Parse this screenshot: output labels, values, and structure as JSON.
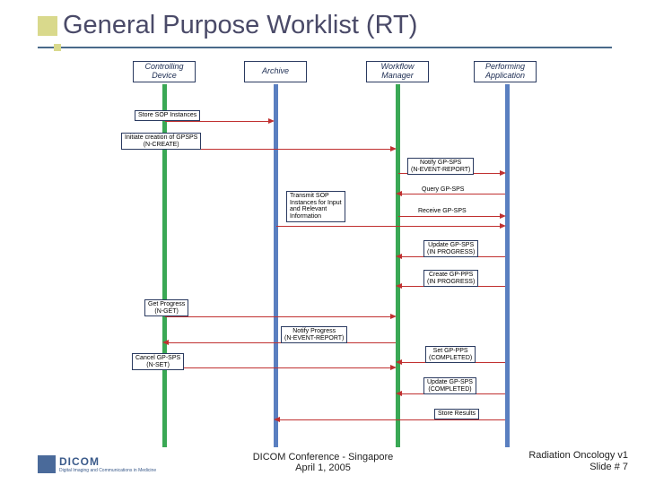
{
  "title": "General Purpose Worklist (RT)",
  "actors": {
    "controlling_device": "Controlling\nDevice",
    "archive": "Archive",
    "workflow_manager": "Workflow\nManager",
    "performing_application": "Performing\nApplication"
  },
  "messages": {
    "store_sop": "Store SOP Instances",
    "initiate_gpsps": "Initiate creation of GPSPS\n(N-CREATE)",
    "notify_gpsps": "Notify GP-SPS\n(N-EVENT-REPORT)",
    "transmit_sop": "Transmit SOP\nInstances for Input\nand Relevant\nInformation",
    "query_gpsps": "Query GP-SPS",
    "receive_gpsps": "Receive GP-SPS",
    "update_gpsps_prog": "Update GP-SPS\n(IN PROGRESS)",
    "create_gppps_prog": "Create GP-PPS\n(IN PROGRESS)",
    "get_progress": "Get Progress\n(N-GET)",
    "notify_progress": "Notify Progress\n(N-EVENT-REPORT)",
    "cancel_gpsps": "Cancel GP-SPS\n(N-SET)",
    "set_gppps_comp": "Set GP-PPS\n(COMPLETED)",
    "update_gpsps_comp": "Update GP-SPS\n(COMPLETED)",
    "store_results": "Store Results"
  },
  "footer": {
    "logo": "DICOM",
    "logo_sub": "Digital Imaging and Communications in Medicine",
    "center1": "DICOM Conference - Singapore",
    "center2": "April 1, 2005",
    "right1": "Radiation Oncology  v1",
    "right2": "Slide # 7"
  }
}
